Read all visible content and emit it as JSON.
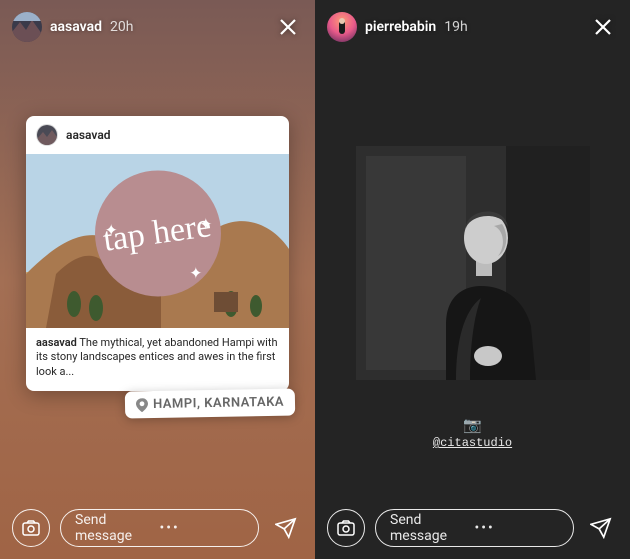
{
  "stories": [
    {
      "username": "aasavad",
      "time": "20h",
      "card_username": "aasavad",
      "caption_user": "aasavad",
      "caption_text": " The mythical, yet abandoned Hampi with its stony landscapes entices and awes in the first look a...",
      "sticker_text": "tap here",
      "geo_label": "HAMPI, KARNATAKA",
      "send_placeholder": "Send message"
    },
    {
      "username": "pierrebabin",
      "time": "19h",
      "credit_handle": "@citastudio",
      "send_placeholder": "Send message"
    }
  ]
}
